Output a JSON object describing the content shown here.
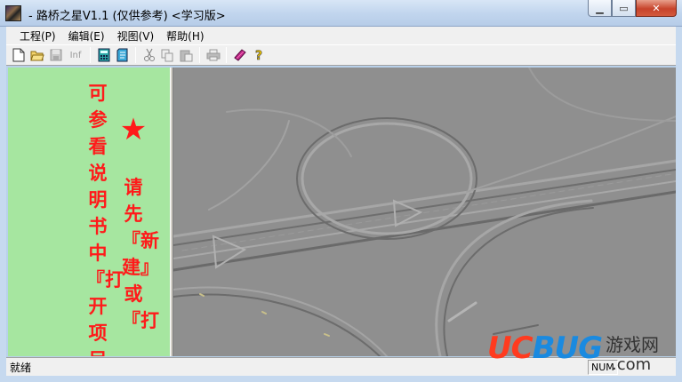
{
  "window": {
    "title": " - 路桥之星V1.1 (仅供参考) <学习版>",
    "buttons": {
      "minimize": "▁",
      "maximize": "▭",
      "close": "✕"
    }
  },
  "menu": [
    {
      "label": "工程(P)"
    },
    {
      "label": "编辑(E)"
    },
    {
      "label": "视图(V)"
    },
    {
      "label": "帮助(H)"
    }
  ],
  "toolbar": {
    "icons": [
      "new-file-icon",
      "open-folder-icon",
      "save-icon",
      "info-icon",
      "calculator-icon",
      "document-icon",
      "cut-icon",
      "copy-icon",
      "paste-icon",
      "print-icon",
      "book-icon",
      "help-icon"
    ],
    "inf_label": "Inf"
  },
  "left_pane": {
    "column1": "可参看说明书中『打开项目",
    "star": "★",
    "column2": "请先『新建』或『打"
  },
  "status": {
    "text": "就绪",
    "panel_num": "NUM"
  },
  "watermark": {
    "uc": "UC",
    "bug": "BUG",
    "cn": "游戏网",
    "com": ".com"
  },
  "colors": {
    "left_bg": "#a6e6a0",
    "left_text": "#ff1a1a",
    "image_bg": "#8e8e8e"
  }
}
